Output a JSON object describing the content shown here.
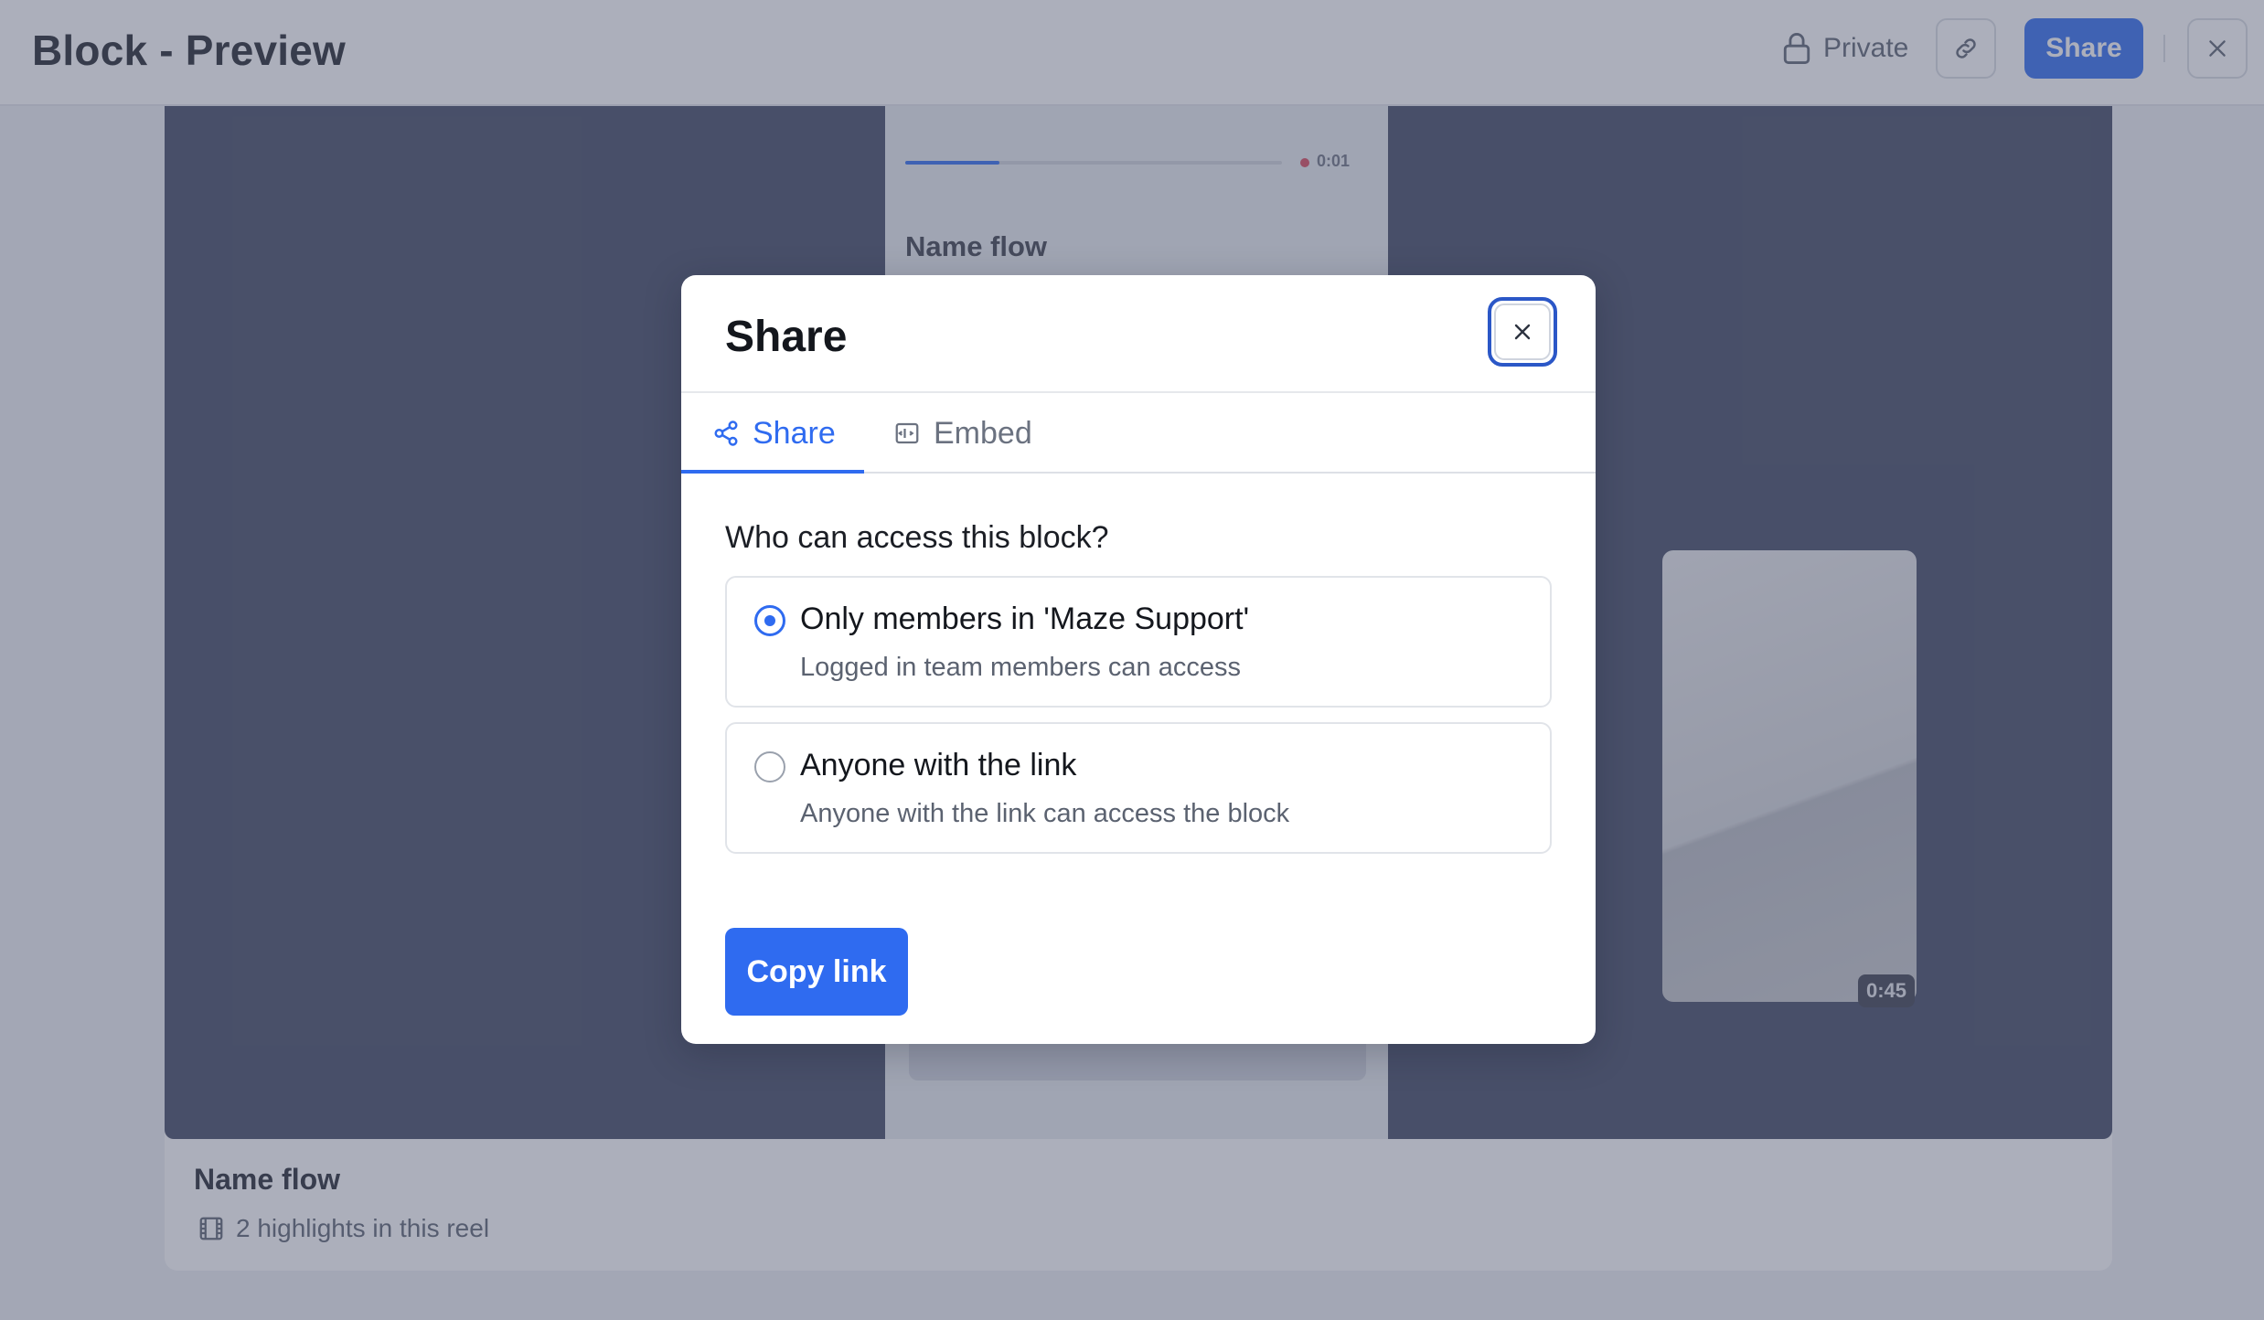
{
  "header": {
    "title": "Block - Preview",
    "privacy_label": "Private",
    "share_label": "Share"
  },
  "video": {
    "phone_time": "0:01",
    "phone_heading": "Name flow",
    "phone_progress": 0.25,
    "pip_time": "0:45"
  },
  "reel": {
    "title": "Name flow",
    "meta": "2 highlights in this reel"
  },
  "modal": {
    "title": "Share",
    "tabs": [
      {
        "label": "Share",
        "icon": "share-nodes-icon",
        "active": true
      },
      {
        "label": "Embed",
        "icon": "embed-icon",
        "active": false
      }
    ],
    "question": "Who can access this block?",
    "options": [
      {
        "label": "Only members in 'Maze Support'",
        "description": "Logged in team members can access",
        "selected": true
      },
      {
        "label": "Anyone with the link",
        "description": "Anyone with the link can access the block",
        "selected": false
      }
    ],
    "copy_label": "Copy link"
  },
  "colors": {
    "accent": "#2f6bf0",
    "focus_ring": "#2b57c7",
    "overlay": "rgba(82, 88, 112, 0.48)",
    "video_bg": "#404862"
  }
}
